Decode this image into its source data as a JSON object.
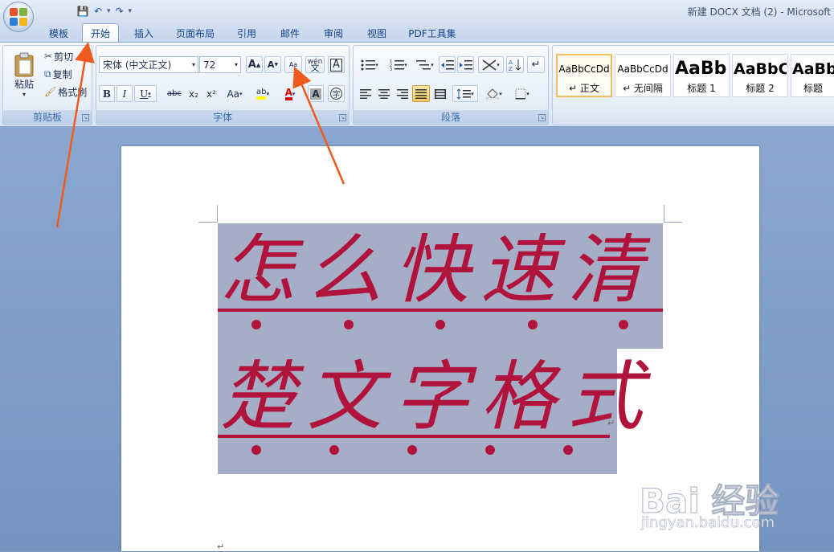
{
  "window": {
    "title": "新建 DOCX 文档 (2) - Microsoft"
  },
  "quick_access": {
    "save": "💾",
    "undo": "↶",
    "redo": "↷",
    "more": "▾"
  },
  "tabs": [
    "模板",
    "开始",
    "插入",
    "页面布局",
    "引用",
    "邮件",
    "审阅",
    "视图",
    "PDF工具集"
  ],
  "active_tab": "开始",
  "clipboard": {
    "paste": "粘贴",
    "cut": "剪切",
    "copy": "复制",
    "format_painter": "格式刷",
    "label": "剪贴板"
  },
  "font": {
    "name": "宋体 (中文正文)",
    "size": "72",
    "grow": "A",
    "shrink": "A",
    "clear_format": "Aa",
    "phonetic": "wén",
    "border_char": "A",
    "bold": "B",
    "italic": "I",
    "underline": "U",
    "strike": "abc",
    "sub": "x₂",
    "sup": "x²",
    "change_case": "Aa",
    "highlight": "ab",
    "color": "A",
    "shade": "A",
    "enclose": "字",
    "label": "字体"
  },
  "paragraph": {
    "label": "段落"
  },
  "styles": [
    {
      "sample": "AaBbCcDd",
      "name": "↵ 正文"
    },
    {
      "sample": "AaBbCcDd",
      "name": "↵ 无间隔"
    },
    {
      "sample": "AaBb",
      "name": "标题 1"
    },
    {
      "sample": "AaBbC",
      "name": "标题 2"
    },
    {
      "sample": "AaBb",
      "name": "标题"
    }
  ],
  "document": {
    "line1": "怎么快速清",
    "line2": "楚文字格式",
    "para_mark": "↵"
  },
  "colors": {
    "text": "#b0133b",
    "selection": "#a5aec6",
    "arrow": "#f05a1e"
  },
  "watermark": {
    "text": "Bai 经验",
    "url": "jingyan.baidu.com"
  }
}
